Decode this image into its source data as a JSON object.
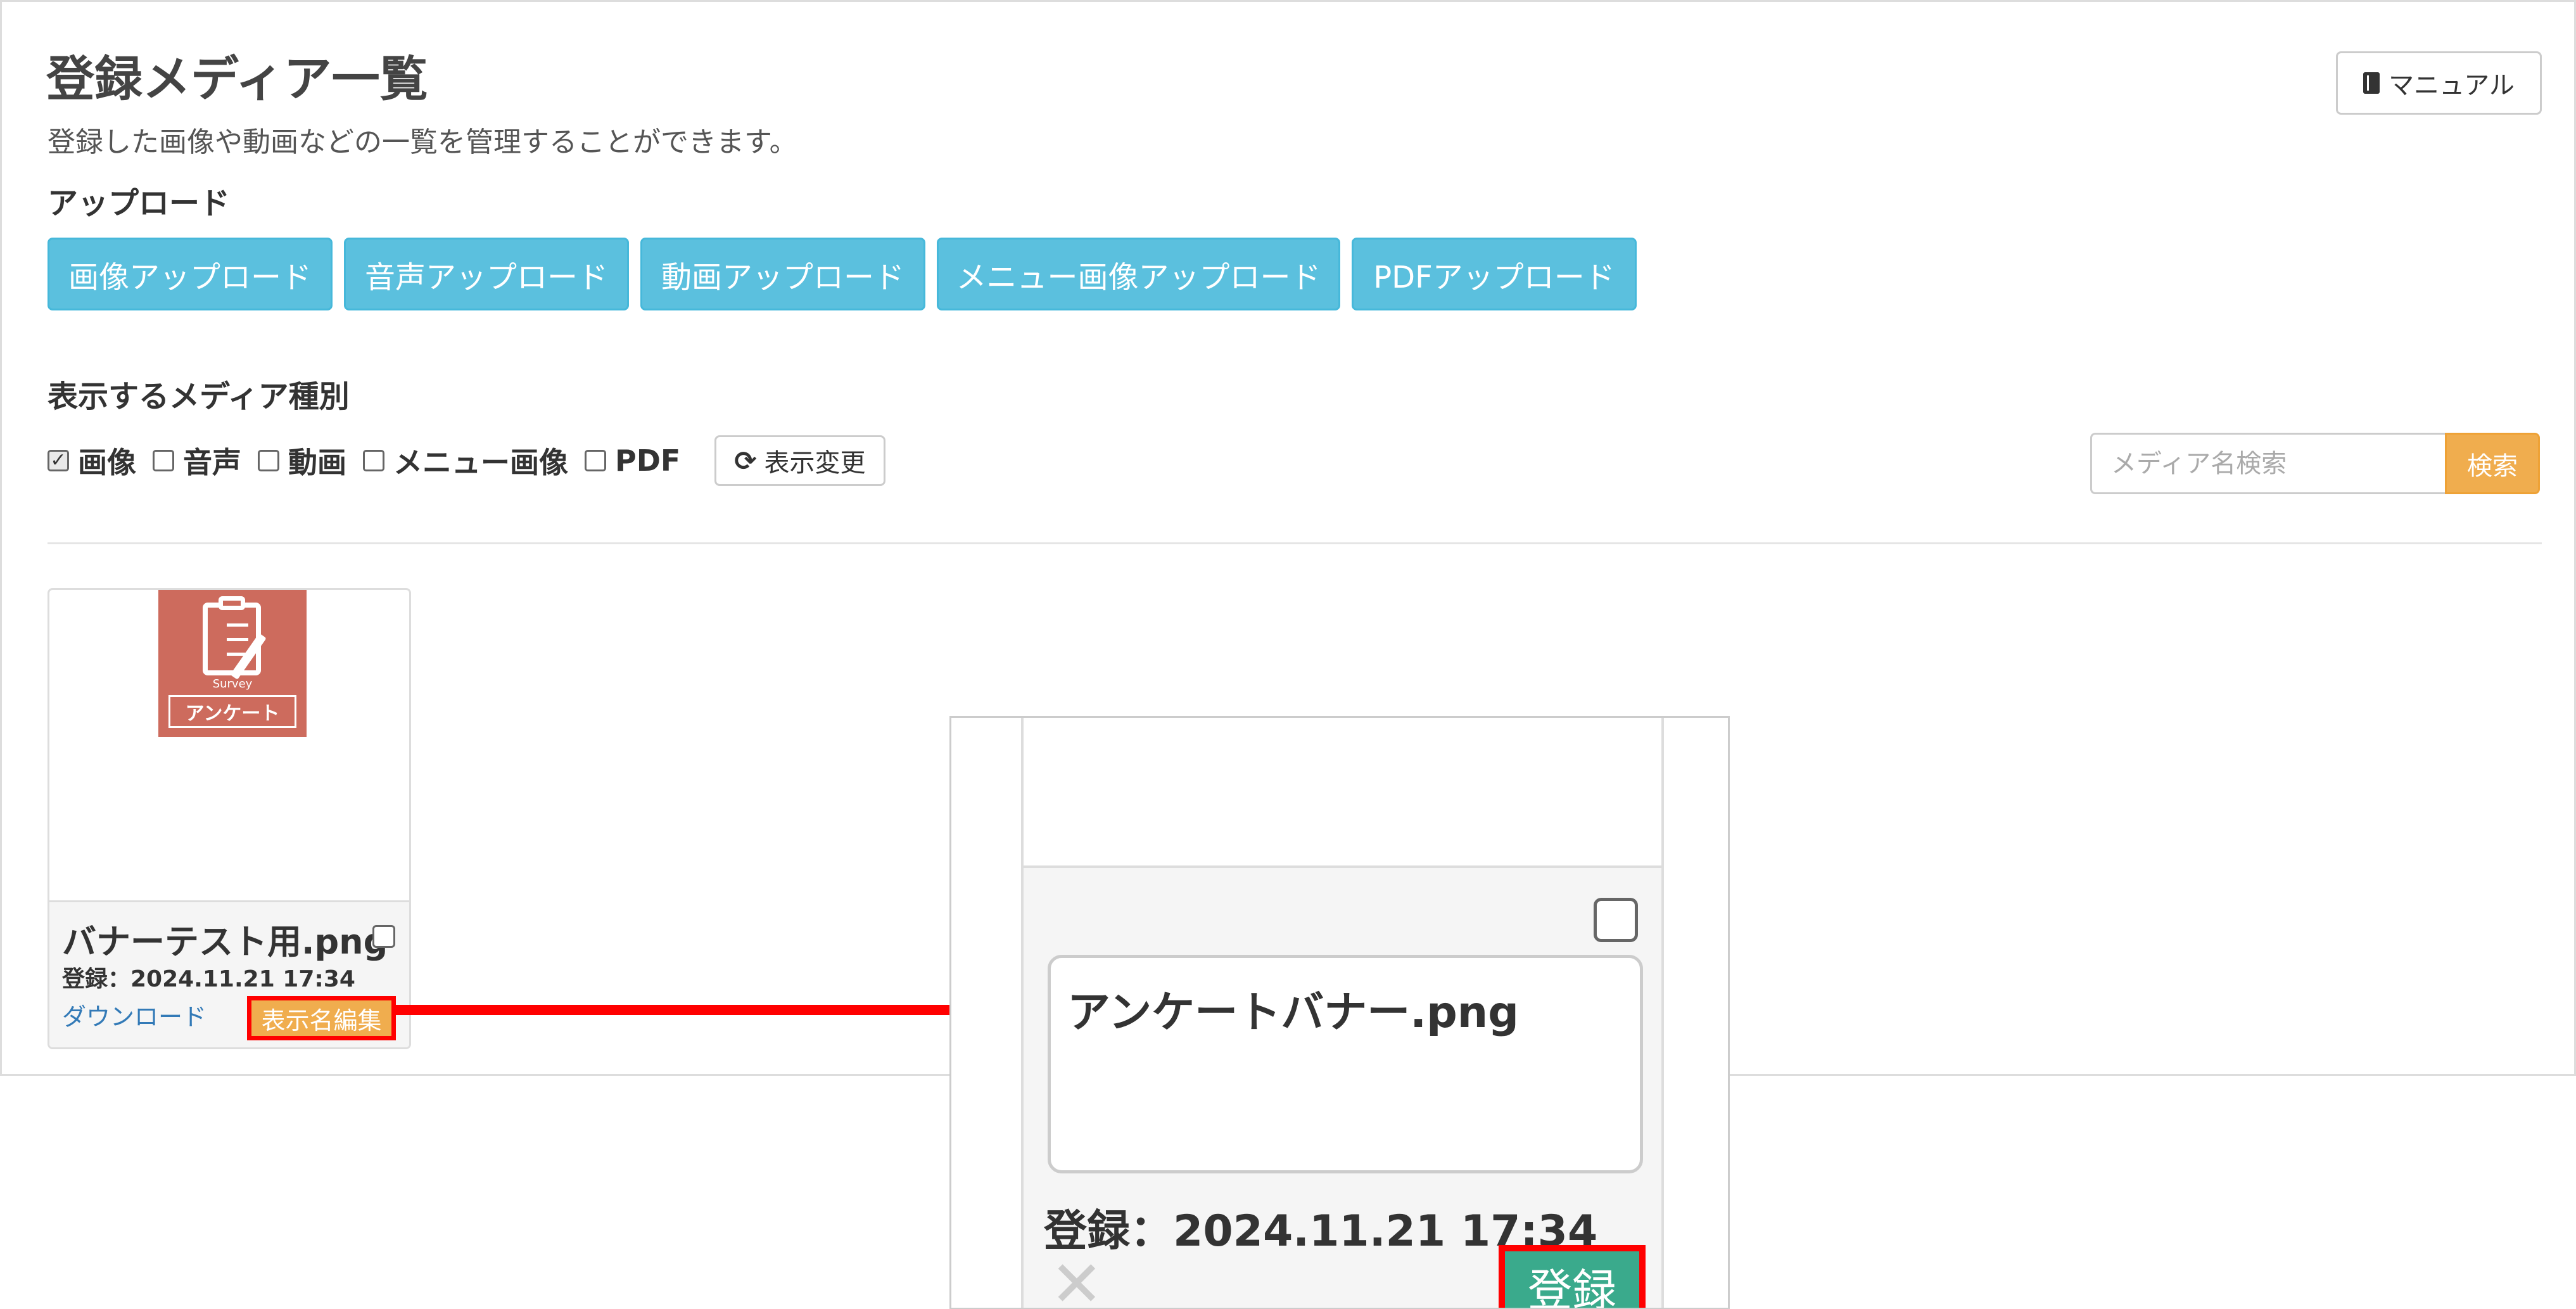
{
  "header": {
    "title": "登録メディア一覧",
    "description": "登録した画像や動画などの一覧を管理することができます。",
    "manual_label": "マニュアル",
    "manual_icon": "book-icon"
  },
  "upload": {
    "section_label": "アップロード",
    "buttons": [
      "画像アップロード",
      "音声アップロード",
      "動画アップロード",
      "メニュー画像アップロード",
      "PDFアップロード"
    ]
  },
  "filter": {
    "section_label": "表示するメディア種別",
    "options": [
      {
        "label": "画像",
        "checked": true
      },
      {
        "label": "音声",
        "checked": false
      },
      {
        "label": "動画",
        "checked": false
      },
      {
        "label": "メニュー画像",
        "checked": false
      },
      {
        "label": "PDF",
        "checked": false
      }
    ],
    "apply_label": "表示変更",
    "apply_icon": "refresh-icon"
  },
  "search": {
    "placeholder": "メディア名検索",
    "value": "",
    "button_label": "検索"
  },
  "media_card": {
    "thumbnail": {
      "small_text": "Survey",
      "banner_text": "アンケート",
      "background_color": "#cd6b5d"
    },
    "name": "バナーテスト用.png",
    "selected": false,
    "date": "登録：2024.11.21 17:34",
    "download_label": "ダウンロード",
    "edit_label": "表示名編集"
  },
  "zoom_detail": {
    "name_value": "アンケートバナー.png",
    "selected": false,
    "date": "登録：2024.11.21 17:34",
    "cancel_icon": "close-icon",
    "submit_label": "登録"
  },
  "colors": {
    "upload_button": "#5bc0de",
    "search_button": "#f0ad4e",
    "submit_button": "#3aaa8c",
    "highlight": "#ff0000",
    "link": "#337ab7"
  }
}
